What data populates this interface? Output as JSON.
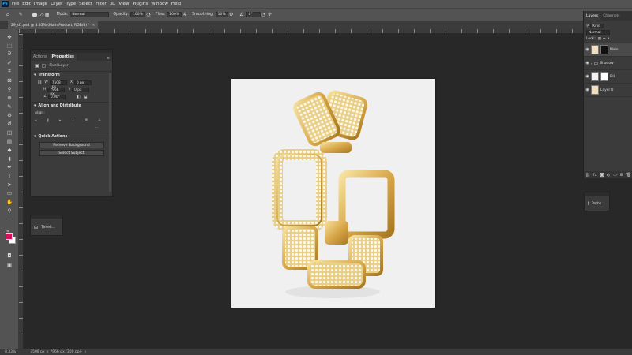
{
  "app": {
    "logo_text": "Ps"
  },
  "menu": [
    "File",
    "Edit",
    "Image",
    "Layer",
    "Type",
    "Select",
    "Filter",
    "3D",
    "View",
    "Plugins",
    "Window",
    "Help"
  ],
  "options_bar": {
    "brush_size": "175",
    "mode_label": "Mode:",
    "mode_value": "Normal",
    "opacity_label": "Opacity:",
    "opacity_value": "100%",
    "flow_label": "Flow:",
    "flow_value": "100%",
    "smoothing_label": "Smoothing:",
    "smoothing_value": "10%",
    "angle_value": "0°"
  },
  "document_tab": {
    "title": "29_d1.psd @ 8.33% (Main Product, RGB/8) *",
    "close": "×"
  },
  "properties_panel": {
    "tabs": [
      "Actions",
      "Properties"
    ],
    "active_tab": "Properties",
    "layer_type": "Pixel Layer",
    "transform_title": "Transform",
    "w_label": "W",
    "w_value": "7508 px",
    "h_label": "H",
    "h_value": "7966 px",
    "x_label": "X",
    "x_value": "0 px",
    "y_label": "Y",
    "y_value": "0 px",
    "angle_value": "0.00°",
    "align_title": "Align and Distribute",
    "align_label": "Align:",
    "more": "...",
    "quick_actions_title": "Quick Actions",
    "remove_bg": "Remove Background",
    "select_subject": "Select Subject"
  },
  "timeline_panel": {
    "label": "Timeli..."
  },
  "layers_panel": {
    "tabs": [
      "Layers",
      "Channels"
    ],
    "active_tab": "Layers",
    "filter_value": "Kind",
    "blend_mode": "Normal",
    "lock_label": "Lock:",
    "layers": [
      {
        "name": "Main",
        "selected": true
      },
      {
        "name": "Shadow",
        "selected": false
      },
      {
        "name": "Fill",
        "selected": false
      },
      {
        "name": "Layer 0",
        "selected": false
      }
    ]
  },
  "paths_panel": {
    "label": "Paths"
  },
  "status_bar": {
    "zoom": "8.33%",
    "doc_info": "7508 px × 7966 px (300 ppi)"
  },
  "colors": {
    "foreground": "#d4145a",
    "background": "#ffffff",
    "canvas": "#f0f0f0",
    "accent": "#31a8ff"
  }
}
